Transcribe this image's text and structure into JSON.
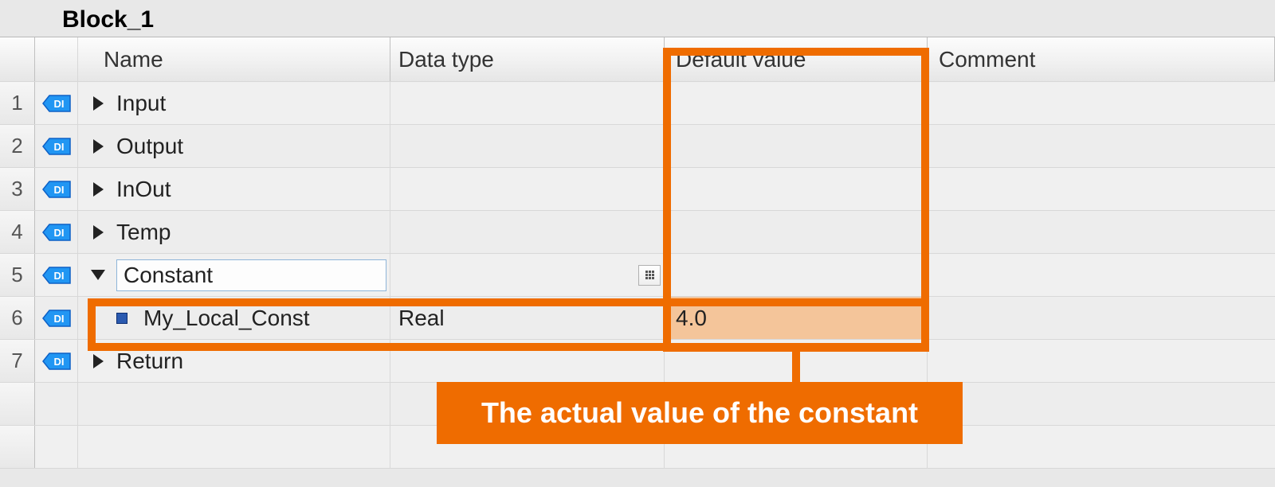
{
  "block_title": "Block_1",
  "columns": {
    "name": "Name",
    "datatype": "Data type",
    "default": "Default value",
    "comment": "Comment"
  },
  "rows": [
    {
      "num": "1",
      "label": "Input",
      "expanded": false,
      "child": false
    },
    {
      "num": "2",
      "label": "Output",
      "expanded": false,
      "child": false
    },
    {
      "num": "3",
      "label": "InOut",
      "expanded": false,
      "child": false
    },
    {
      "num": "4",
      "label": "Temp",
      "expanded": false,
      "child": false
    },
    {
      "num": "5",
      "label": "Constant",
      "expanded": true,
      "child": false
    },
    {
      "num": "6",
      "label": "My_Local_Const",
      "expanded": false,
      "child": true,
      "datatype": "Real",
      "default": "4.0"
    },
    {
      "num": "7",
      "label": "Return",
      "expanded": false,
      "child": false
    }
  ],
  "annotation": "The actual value of the constant",
  "colors": {
    "highlight": "#ef6c00"
  }
}
